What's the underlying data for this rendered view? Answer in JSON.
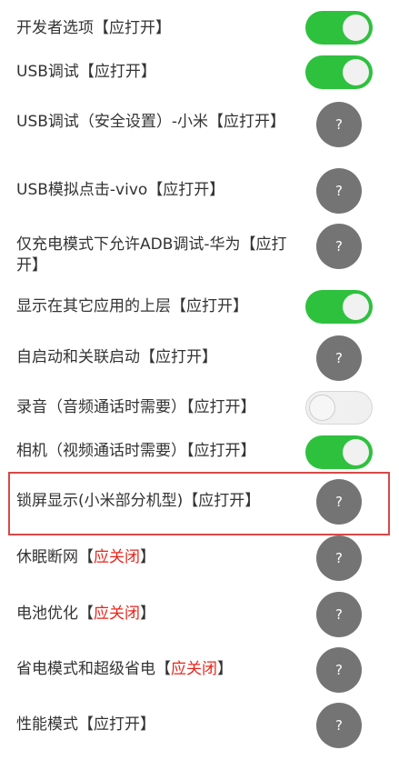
{
  "help_glyph": "?",
  "rows": [
    {
      "label": "开发者选项【应打开】",
      "warn": "",
      "control": "toggle-on"
    },
    {
      "label": "USB调试【应打开】",
      "warn": "",
      "control": "toggle-on"
    },
    {
      "label": "USB调试（安全设置）-小米【应打开】",
      "warn": "",
      "control": "help"
    },
    {
      "label": "USB模拟点击-vivo【应打开】",
      "warn": "",
      "control": "help"
    },
    {
      "label": "仅充电模式下允许ADB调试-华为【应打开】",
      "warn": "",
      "control": "help"
    },
    {
      "label": "显示在其它应用的上层【应打开】",
      "warn": "",
      "control": "toggle-on"
    },
    {
      "label": "自启动和关联启动【应打开】",
      "warn": "",
      "control": "help"
    },
    {
      "label": "录音（音频通话时需要）【应打开】",
      "warn": "",
      "control": "toggle-off"
    },
    {
      "label": "相机（视频通话时需要）【应打开】",
      "warn": "",
      "control": "toggle-on"
    },
    {
      "label": "锁屏显示(小米部分机型)【应打开】",
      "warn": "",
      "control": "help"
    },
    {
      "label": "休眠断网【",
      "warn": "应关闭",
      "tail": "】",
      "control": "help"
    },
    {
      "label": "电池优化【",
      "warn": "应关闭",
      "tail": "】",
      "control": "help"
    },
    {
      "label": "省电模式和超级省电【",
      "warn": "应关闭",
      "tail": "】",
      "control": "help"
    },
    {
      "label": "性能模式【应打开】",
      "warn": "",
      "control": "help"
    }
  ]
}
